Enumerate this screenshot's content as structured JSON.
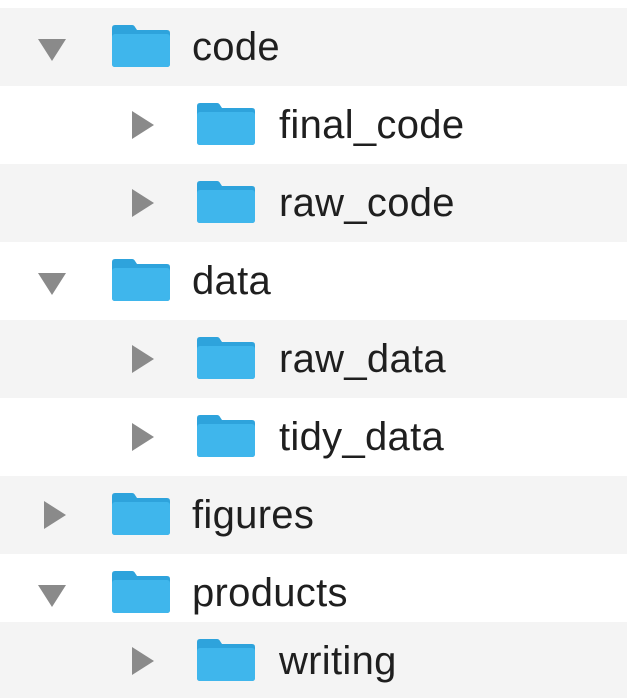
{
  "tree": {
    "items": [
      {
        "label": "code",
        "level": 0,
        "expanded": true
      },
      {
        "label": "final_code",
        "level": 1,
        "expanded": false
      },
      {
        "label": "raw_code",
        "level": 1,
        "expanded": false
      },
      {
        "label": "data",
        "level": 0,
        "expanded": true
      },
      {
        "label": "raw_data",
        "level": 1,
        "expanded": false
      },
      {
        "label": "tidy_data",
        "level": 1,
        "expanded": false
      },
      {
        "label": "figures",
        "level": 0,
        "expanded": false
      },
      {
        "label": "products",
        "level": 0,
        "expanded": true
      },
      {
        "label": "writing",
        "level": 1,
        "expanded": false
      }
    ]
  },
  "colors": {
    "folder_body": "#3fb6ec",
    "folder_tab": "#2ea3dc",
    "disclosure": "#8a8a8a",
    "row_alt": "#f4f4f4"
  },
  "icons": {
    "expanded": "disclosure-triangle-down-icon",
    "collapsed": "disclosure-triangle-right-icon",
    "folder": "folder-icon"
  }
}
